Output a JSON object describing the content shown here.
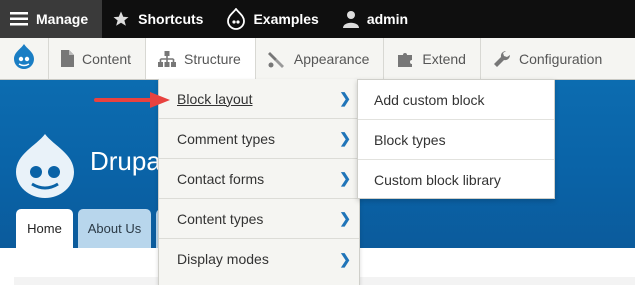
{
  "toolbar": {
    "manage_label": "Manage",
    "shortcuts_label": "Shortcuts",
    "examples_label": "Examples",
    "user_label": "admin"
  },
  "tray": {
    "items": [
      {
        "label": "Content",
        "icon": "page-icon"
      },
      {
        "label": "Structure",
        "icon": "structure-icon"
      },
      {
        "label": "Appearance",
        "icon": "wrench-brush-icon"
      },
      {
        "label": "Extend",
        "icon": "puzzle-icon"
      },
      {
        "label": "Configuration",
        "icon": "wrench-icon"
      }
    ]
  },
  "site": {
    "name_partial": "Drupa",
    "tabs": [
      "Home",
      "About Us"
    ]
  },
  "structure_menu": [
    "Block layout",
    "Comment types",
    "Contact forms",
    "Content types",
    "Display modes"
  ],
  "block_submenu": [
    "Add custom block",
    "Block types",
    "Custom block library"
  ],
  "colors": {
    "toolbar_bg": "#0f0f0f",
    "header_blue": "#0a63a7",
    "link_blue": "#1f74b8",
    "arrow_red": "#e8423f"
  }
}
